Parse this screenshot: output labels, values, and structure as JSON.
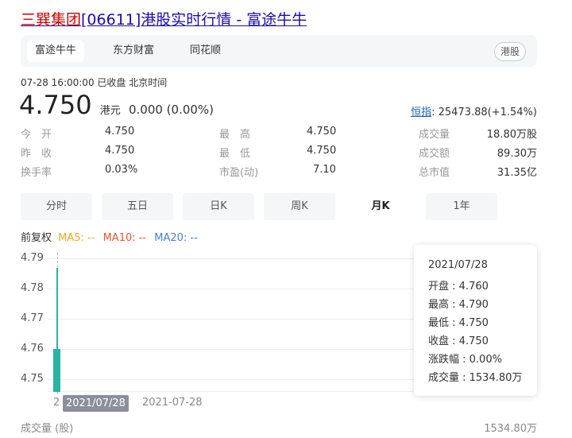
{
  "title": {
    "company": "三巽集团",
    "rest": "[06611]港股实时行情 - 富途牛牛"
  },
  "sources": {
    "tabs": [
      "富途牛牛",
      "东方财富",
      "同花顺"
    ],
    "market": "港股"
  },
  "status": {
    "time": "07-28 16:00:00",
    "state": "已收盘",
    "zone": "北京时间"
  },
  "price": {
    "value": "4.750",
    "unit": "港元",
    "change": "0.000 (0.00%)"
  },
  "index": {
    "name": "恒指",
    "value": ": 25473.88(+1.54%)"
  },
  "stats": [
    {
      "label": "今　开",
      "value": "4.750"
    },
    {
      "label": "昨　收",
      "value": "4.750"
    },
    {
      "label": "换手率",
      "value": "0.03%"
    },
    {
      "label": "最　高",
      "value": "4.750"
    },
    {
      "label": "最　低",
      "value": "4.750"
    },
    {
      "label": "市盈(动)",
      "value": "7.10"
    },
    {
      "label": "成交量",
      "value": "18.80万股"
    },
    {
      "label": "成交额",
      "value": "89.30万"
    },
    {
      "label": "总市值",
      "value": "31.35亿"
    }
  ],
  "periods": [
    "分时",
    "五日",
    "日K",
    "周K",
    "月K",
    "1年"
  ],
  "active_period": "月K",
  "ma": {
    "label": "前复权",
    "ma5": "MA5: --",
    "ma10": "MA10: --",
    "ma20": "MA20: --",
    "colors": {
      "ma5": "#f5a623",
      "ma10": "#e8562e",
      "ma20": "#4a7bd6"
    }
  },
  "chart_data": {
    "type": "candlestick",
    "y_ticks": [
      "4.79",
      "4.78",
      "4.77",
      "4.76",
      "4.75"
    ],
    "ylim": [
      4.75,
      4.79
    ],
    "candles": [
      {
        "date": "2021/07/28",
        "open": 4.76,
        "high": 4.79,
        "low": 4.75,
        "close": 4.75
      }
    ],
    "x_label_left": "2",
    "x_highlight": "2021/07/28",
    "x_date": "2021-07-28",
    "candle_color": "#2ab3a0"
  },
  "tooltip": [
    "2021/07/28",
    "开盘 : 4.760",
    "最高 : 4.790",
    "最低 : 4.750",
    "收盘 : 4.750",
    "涨跌幅 : 0.00%",
    "成交量 : 1534.80万"
  ],
  "volume": {
    "label": "成交量 (股)",
    "value": "1534.80万"
  }
}
